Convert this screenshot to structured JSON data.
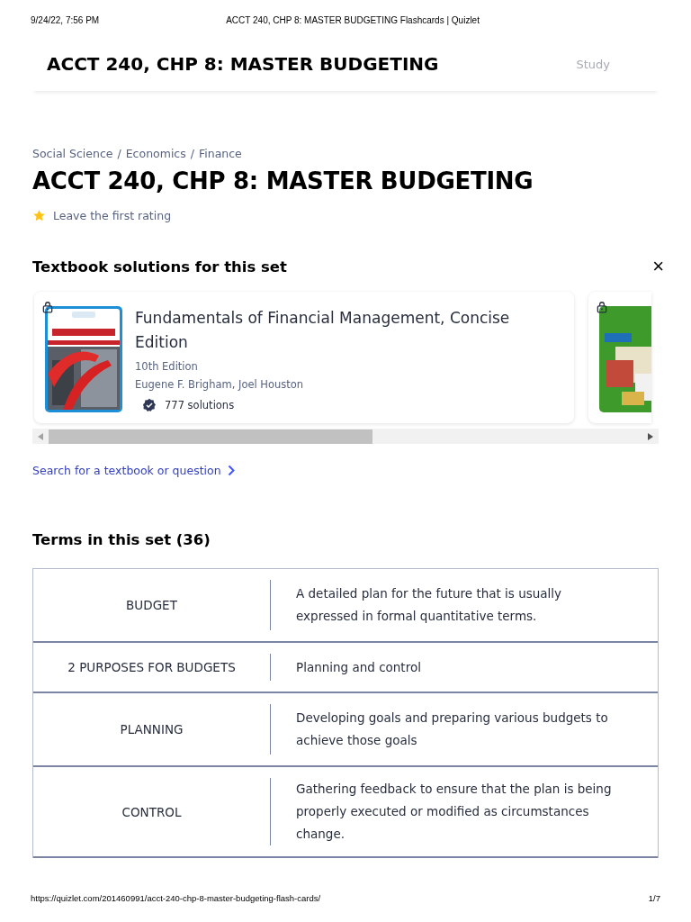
{
  "print_header": {
    "date": "9/24/22, 7:56 PM",
    "title": "ACCT 240, CHP 8: MASTER BUDGETING Flashcards | Quizlet"
  },
  "header": {
    "title": "ACCT 240, CHP 8: MASTER BUDGETING",
    "study": "Study"
  },
  "breadcrumbs": [
    "Social Science",
    "Economics",
    "Finance"
  ],
  "breadcrumb_separator": "/",
  "title": "ACCT 240, CHP 8: MASTER BUDGETING",
  "rating": {
    "label": "Leave the first rating"
  },
  "textbooks": {
    "heading": "Textbook solutions for this set",
    "close": "×",
    "books": [
      {
        "locked": true,
        "title": "Fundamentals of Financial Management, Concise Edition",
        "edition": "10th Edition",
        "authors": "Eugene F. Brigham, Joel Houston",
        "solutions": "777 solutions"
      },
      {
        "locked": true
      }
    ],
    "search_link": "Search for a textbook or question"
  },
  "terms": {
    "heading": "Terms in this set (36)",
    "rows": [
      {
        "term": "BUDGET",
        "definition": "A detailed plan for the future that is usually expressed in formal quantitative terms."
      },
      {
        "term": "2 PURPOSES FOR BUDGETS",
        "definition": "Planning and control"
      },
      {
        "term": "PLANNING",
        "definition": "Developing goals and preparing various budgets to achieve those goals"
      },
      {
        "term": "CONTROL",
        "definition": "Gathering feedback to ensure that the plan is being properly executed or modified as circumstances change."
      }
    ]
  },
  "print_footer": {
    "url": "https://quizlet.com/201460991/acct-240-chp-8-master-budgeting-flash-cards/",
    "page": "1/7"
  }
}
